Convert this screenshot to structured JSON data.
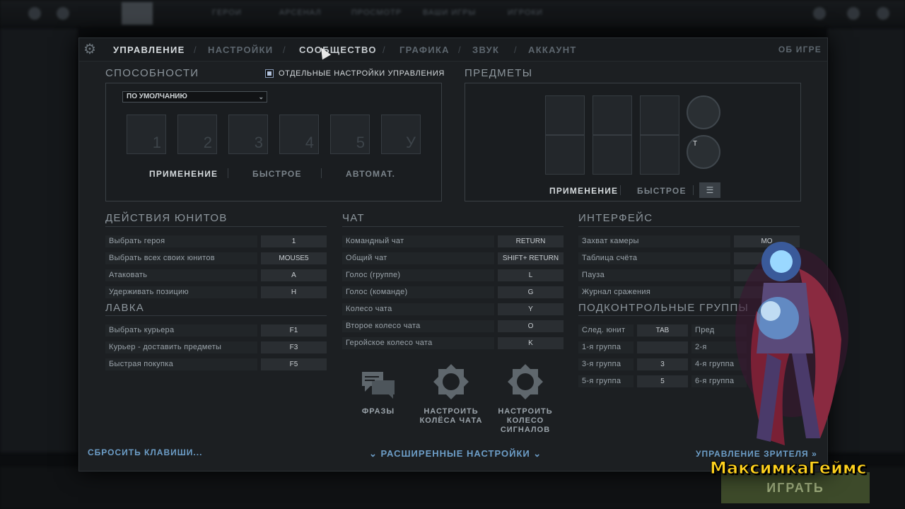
{
  "tabs": [
    "УПРАВЛЕНИЕ",
    "НАСТРОЙКИ",
    "СООБЩЕСТВО",
    "ГРАФИКА",
    "ЗВУК",
    "АККАУНТ"
  ],
  "active_tab": "УПРАВЛЕНИЕ",
  "about": "ОБ ИГРЕ",
  "abilities": {
    "title": "СПОСОБНОСТИ",
    "separate_controls_label": "ОТДЕЛЬНЫЕ НАСТРОЙКИ УПРАВЛЕНИЯ",
    "dropdown_value": "ПО УМОЛЧАНИЮ",
    "slots": [
      "1",
      "2",
      "3",
      "4",
      "5",
      "У"
    ],
    "modes": [
      "ПРИМЕНЕНИЕ",
      "БЫСТРОЕ",
      "АВТОМАТ."
    ]
  },
  "items": {
    "title": "ПРЕДМЕТЫ",
    "modes": [
      "ПРИМЕНЕНИЕ",
      "БЫСТРОЕ"
    ],
    "tp_key": "T"
  },
  "unit_actions": {
    "title": "ДЕЙСТВИЯ ЮНИТОВ",
    "rows": [
      {
        "label": "Выбрать героя",
        "key": "1"
      },
      {
        "label": "Выбрать всех своих юнитов",
        "key": "MOUSE5"
      },
      {
        "label": "Атаковать",
        "key": "A"
      },
      {
        "label": "Удерживать позицию",
        "key": "H"
      }
    ]
  },
  "shop": {
    "title": "ЛАВКА",
    "rows": [
      {
        "label": "Выбрать курьера",
        "key": "F1"
      },
      {
        "label": "Курьер - доставить предметы",
        "key": "F3"
      },
      {
        "label": "Быстрая покупка",
        "key": "F5"
      }
    ]
  },
  "chat": {
    "title": "ЧАТ",
    "rows": [
      {
        "label": "Командный чат",
        "key": "RETURN"
      },
      {
        "label": "Общий чат",
        "key": "SHIFT+ RETURN"
      },
      {
        "label": "Голос (группе)",
        "key": "L"
      },
      {
        "label": "Голос (команде)",
        "key": "G"
      },
      {
        "label": "Колесо чата",
        "key": "Y"
      },
      {
        "label": "Второе колесо чата",
        "key": "O"
      },
      {
        "label": "Геройское колесо чата",
        "key": "K"
      }
    ],
    "buttons": [
      "ФРАЗЫ",
      "НАСТРОИТЬ КОЛЁСА ЧАТА",
      "НАСТРОИТЬ КОЛЕСО СИГНАЛОВ"
    ]
  },
  "interface": {
    "title": "ИНТЕРФЕЙС",
    "rows": [
      {
        "label": "Захват камеры",
        "key": "MO"
      },
      {
        "label": "Таблица счёта",
        "key": ""
      },
      {
        "label": "Пауза",
        "key": ""
      },
      {
        "label": "Журнал сражения",
        "key": ""
      }
    ]
  },
  "control_groups": {
    "title": "ПОДКОНТРОЛЬНЫЕ ГРУППЫ",
    "rows": [
      {
        "label": "След. юнит",
        "key": "TAB",
        "label2": "Пред"
      },
      {
        "label": "1-я группа",
        "key": "",
        "label2": "2-я"
      },
      {
        "label": "3-я группа",
        "key": "3",
        "label2": "4-я группа"
      },
      {
        "label": "5-я группа",
        "key": "5",
        "label2": "6-я группа"
      }
    ]
  },
  "footer": {
    "reset": "СБРОСИТЬ КЛАВИШИ...",
    "advanced": "РАСШИРЕННЫЕ НАСТРОЙКИ",
    "spectator": "УПРАВЛЕНИЕ ЗРИТЕЛЯ"
  },
  "background": {
    "play_button": "ИГРАТЬ",
    "top_nav": [
      "ГЕРОИ",
      "АРСЕНАЛ",
      "ПРОСМОТР",
      "ВАШИ ИГРЫ",
      "ИГРОКИ"
    ]
  },
  "watermark": "МаксимкаГеймс",
  "colors": {
    "accent_link": "#6d9ec8",
    "watermark": "#ffd21e",
    "active_tab": "#d8dde0"
  }
}
